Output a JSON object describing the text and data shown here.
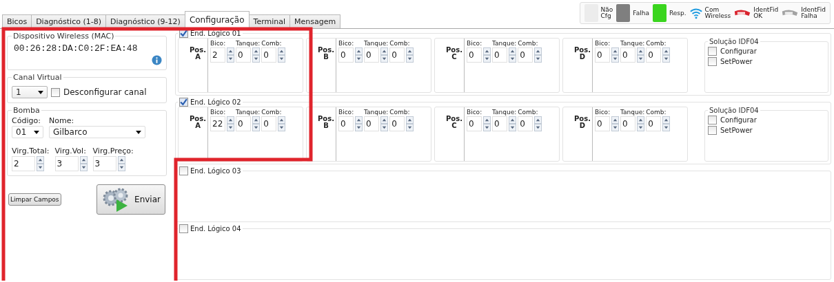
{
  "tabs": [
    {
      "label": "Bicos",
      "selected": false
    },
    {
      "label": "Diagnóstico (1-8)",
      "selected": false
    },
    {
      "label": "Diagnóstico (9-12)",
      "selected": false
    },
    {
      "label": "Configuração",
      "selected": true
    },
    {
      "label": "Terminal",
      "selected": false
    },
    {
      "label": "Mensagem",
      "selected": false
    }
  ],
  "legend": [
    {
      "kind": "swatch",
      "color": "#ececec",
      "label": "Não Cfg"
    },
    {
      "kind": "swatch",
      "color": "#7f7f7f",
      "label": "Falha"
    },
    {
      "kind": "swatch",
      "color": "#3ad51e",
      "label": "Resp."
    },
    {
      "kind": "wifi",
      "label": "Com Wireless"
    },
    {
      "kind": "idf",
      "color": "#d9232d",
      "label": "IdentFid OK"
    },
    {
      "kind": "idf",
      "color": "#a3a3a3",
      "label": "IdentFid Falha"
    }
  ],
  "device": {
    "title": "Dispositivo Wireless (MAC)",
    "mac": "00:26:28:DA:C0:2F:EA:48"
  },
  "channel": {
    "title": "Canal Virtual",
    "value": "1",
    "option": {
      "label": "Desconfigurar canal",
      "checked": false
    }
  },
  "pump": {
    "title": "Bomba",
    "code_label": "Código:",
    "name_label": "Nome:",
    "code": "01",
    "name": "Gilbarco",
    "decimals": [
      {
        "label": "Virg.Total:",
        "value": "2"
      },
      {
        "label": "Virg.Vol:",
        "value": "3"
      },
      {
        "label": "Virg.Preço:",
        "value": "3"
      }
    ]
  },
  "clear_button": "Limpar Campos",
  "send_button": "Enviar",
  "addresses": [
    {
      "label": "End. Lógico 01",
      "checked": true,
      "positions": [
        {
          "label": "Pos.",
          "letter": "A",
          "fields": [
            {
              "label": "Bico:",
              "value": "2"
            },
            {
              "label": "Tanque:",
              "value": "0"
            },
            {
              "label": "Comb:",
              "value": "0"
            }
          ]
        },
        {
          "label": "Pos.",
          "letter": "B",
          "fields": [
            {
              "label": "Bico:",
              "value": "0"
            },
            {
              "label": "Tanque:",
              "value": "0"
            },
            {
              "label": "Comb:",
              "value": "0"
            }
          ]
        },
        {
          "label": "Pos.",
          "letter": "C",
          "fields": [
            {
              "label": "Bico:",
              "value": "0"
            },
            {
              "label": "Tanque:",
              "value": "0"
            },
            {
              "label": "Comb:",
              "value": "0"
            }
          ]
        },
        {
          "label": "Pos.",
          "letter": "D",
          "fields": [
            {
              "label": "Bico:",
              "value": "0"
            },
            {
              "label": "Tanque:",
              "value": "0"
            },
            {
              "label": "Comb:",
              "value": "0"
            }
          ]
        }
      ],
      "idf": {
        "title": "Solução IDF04",
        "options": [
          {
            "label": "Configurar",
            "checked": false
          },
          {
            "label": "SetPower",
            "checked": false
          }
        ]
      }
    },
    {
      "label": "End. Lógico 02",
      "checked": true,
      "positions": [
        {
          "label": "Pos.",
          "letter": "A",
          "fields": [
            {
              "label": "Bico:",
              "value": "22"
            },
            {
              "label": "Tanque:",
              "value": "0"
            },
            {
              "label": "Comb:",
              "value": "0"
            }
          ]
        },
        {
          "label": "Pos.",
          "letter": "B",
          "fields": [
            {
              "label": "Bico:",
              "value": "0"
            },
            {
              "label": "Tanque:",
              "value": "0"
            },
            {
              "label": "Comb:",
              "value": "0"
            }
          ]
        },
        {
          "label": "Pos.",
          "letter": "C",
          "fields": [
            {
              "label": "Bico:",
              "value": "0"
            },
            {
              "label": "Tanque:",
              "value": "0"
            },
            {
              "label": "Comb:",
              "value": "0"
            }
          ]
        },
        {
          "label": "Pos.",
          "letter": "D",
          "fields": [
            {
              "label": "Bico:",
              "value": "0"
            },
            {
              "label": "Tanque:",
              "value": "0"
            },
            {
              "label": "Comb:",
              "value": "0"
            }
          ]
        }
      ],
      "idf": {
        "title": "Solução IDF04",
        "options": [
          {
            "label": "Configurar",
            "checked": false
          },
          {
            "label": "SetPower",
            "checked": false
          }
        ]
      }
    },
    {
      "label": "End. Lógico 03",
      "checked": false
    },
    {
      "label": "End. Lógico 04",
      "checked": false
    }
  ]
}
